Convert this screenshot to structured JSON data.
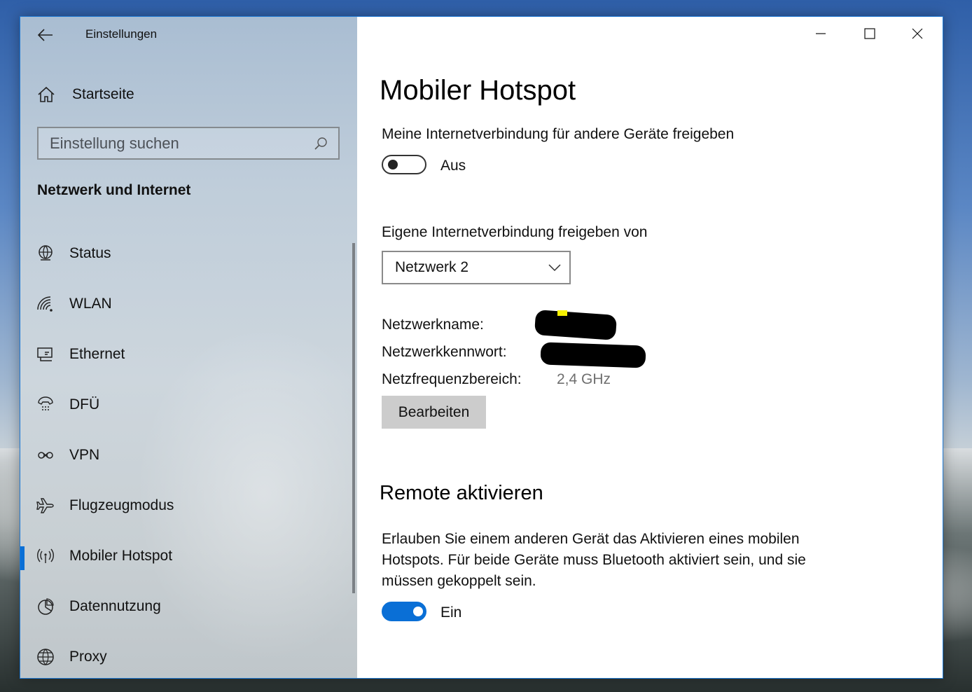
{
  "window": {
    "app_title": "Einstellungen"
  },
  "sidebar": {
    "home_label": "Startseite",
    "search_placeholder": "Einstellung suchen",
    "section_title": "Netzwerk und Internet",
    "items": [
      {
        "label": "Status",
        "icon": "globe-status-icon"
      },
      {
        "label": "WLAN",
        "icon": "wifi-icon"
      },
      {
        "label": "Ethernet",
        "icon": "ethernet-icon"
      },
      {
        "label": "DFÜ",
        "icon": "dialup-icon"
      },
      {
        "label": "VPN",
        "icon": "vpn-icon"
      },
      {
        "label": "Flugzeugmodus",
        "icon": "airplane-icon"
      },
      {
        "label": "Mobiler Hotspot",
        "icon": "hotspot-icon",
        "selected": true
      },
      {
        "label": "Datennutzung",
        "icon": "pie-chart-icon"
      },
      {
        "label": "Proxy",
        "icon": "globe-icon"
      }
    ]
  },
  "main": {
    "title": "Mobiler Hotspot",
    "share_label": "Meine Internetverbindung für andere Geräte freigeben",
    "share_toggle": {
      "state": "off",
      "label": "Aus"
    },
    "share_from_label": "Eigene Internetverbindung freigeben von",
    "share_from_value": "Netzwerk 2",
    "network_name_label": "Netzwerkname:",
    "network_password_label": "Netzwerkkennwort:",
    "band_label": "Netzfrequenzbereich:",
    "band_value": "2,4 GHz",
    "edit_button": "Bearbeiten",
    "remote_title": "Remote aktivieren",
    "remote_description": "Erlauben Sie einem anderen Gerät das Aktivieren eines mobilen Hotspots. Für beide Geräte muss Bluetooth aktiviert sein, und sie müssen gekoppelt sein.",
    "remote_toggle": {
      "state": "on",
      "label": "Ein"
    }
  },
  "colors": {
    "accent": "#0a6fd6",
    "window_border": "#1e79d4"
  }
}
